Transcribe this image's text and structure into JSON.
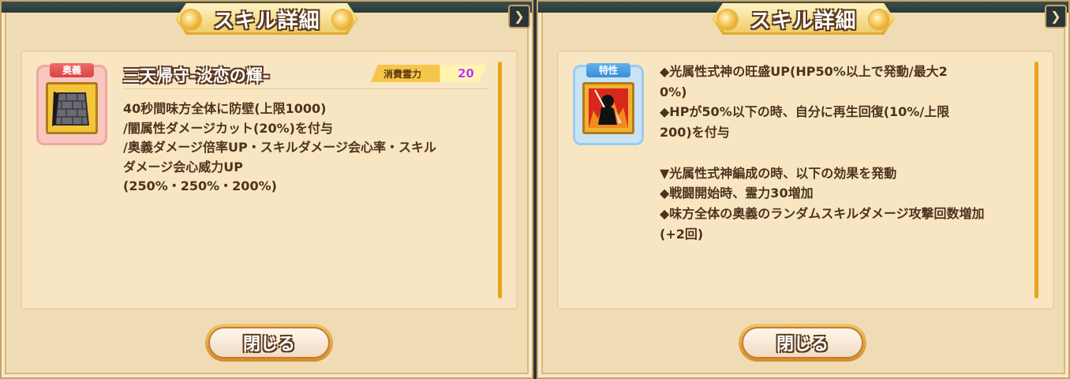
{
  "left_panel": {
    "title": "スキル詳細",
    "tag": "奥義",
    "skill_name": "三天帰守-淡恋の輝-",
    "cost_label": "消費霊力",
    "cost_value": "20",
    "description": "40秒間味方全体に防壁(上限1000)\n/闇属性ダメージカット(20%)を付与\n/奥義ダメージ倍率UP・スキルダメージ会心率・スキル\nダメージ会心威力UP\n(250%・250%・200%)",
    "close_label": "閉じる",
    "icon": "stone-wall-icon"
  },
  "right_panel": {
    "title": "スキル詳細",
    "tag": "特性",
    "description": "◆光属性式神の旺盛UP(HP50%以上で発動/最大2\n0%)\n◆HPが50%以下の時、自分に再生回復(10%/上限\n200)を付与\n\n▼光属性式神編成の時、以下の効果を発動\n◆戦闘開始時、霊力30増加\n◆味方全体の奥義のランダムスキルダメージ攻撃回数増加\n(+2回)",
    "close_label": "閉じる",
    "icon": "fire-swordsman-icon"
  },
  "colors": {
    "panel_bg": "#f0dcb4",
    "content_bg": "#f8e6c3",
    "text": "#4c331d",
    "scroll": "#e7a51c",
    "cost_value": "#c23ad8"
  }
}
